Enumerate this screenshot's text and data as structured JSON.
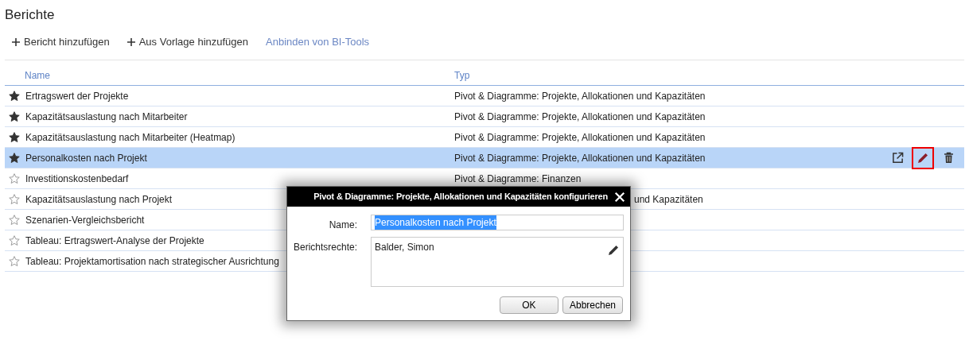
{
  "page": {
    "title": "Berichte"
  },
  "toolbar": [
    {
      "kind": "add",
      "label": "Bericht hinzufügen"
    },
    {
      "kind": "add",
      "label": "Aus Vorlage hinzufügen"
    },
    {
      "kind": "link",
      "label": "Anbinden von BI-Tools"
    }
  ],
  "table": {
    "columns": [
      "Name",
      "Typ"
    ],
    "rows": [
      {
        "favorite": true,
        "selected": false,
        "name": "Ertragswert der Projekte",
        "type": "Pivot & Diagramme: Projekte, Allokationen und Kapazitäten"
      },
      {
        "favorite": true,
        "selected": false,
        "name": "Kapazitätsauslastung nach Mitarbeiter",
        "type": "Pivot & Diagramme: Projekte, Allokationen und Kapazitäten"
      },
      {
        "favorite": true,
        "selected": false,
        "name": "Kapazitätsauslastung nach Mitarbeiter (Heatmap)",
        "type": "Pivot & Diagramme: Projekte, Allokationen und Kapazitäten"
      },
      {
        "favorite": true,
        "selected": true,
        "name": "Personalkosten nach Projekt",
        "type": "Pivot & Diagramme: Projekte, Allokationen und Kapazitäten",
        "actions": [
          {
            "kind": "open",
            "highlighted": false
          },
          {
            "kind": "edit",
            "highlighted": true
          },
          {
            "kind": "delete",
            "highlighted": false
          }
        ]
      },
      {
        "favorite": false,
        "selected": false,
        "name": "Investitionskostenbedarf",
        "type": "Pivot & Diagramme: Finanzen"
      },
      {
        "favorite": false,
        "selected": false,
        "name": "Kapazitätsauslastung nach Projekt",
        "type": "und Kapazitäten",
        "type_covered": true
      },
      {
        "favorite": false,
        "selected": false,
        "name": "Szenarien-Vergleichsbericht"
      },
      {
        "favorite": false,
        "selected": false,
        "name": "Tableau: Ertragswert-Analyse der Projekte"
      },
      {
        "favorite": false,
        "selected": false,
        "name": "Tableau: Projektamortisation nach strategischer Ausrichtung"
      }
    ]
  },
  "dialog": {
    "title": "Pivot & Diagramme: Projekte, Allokationen und Kapazitäten konfigurieren",
    "name_label": "Name:",
    "name_value": "Personalkosten nach Projekt",
    "name_value_selected": true,
    "rights_label": "Berichtsrechte:",
    "rights_value": "Balder, Simon",
    "buttons": [
      "OK",
      "Abbrechen"
    ]
  }
}
